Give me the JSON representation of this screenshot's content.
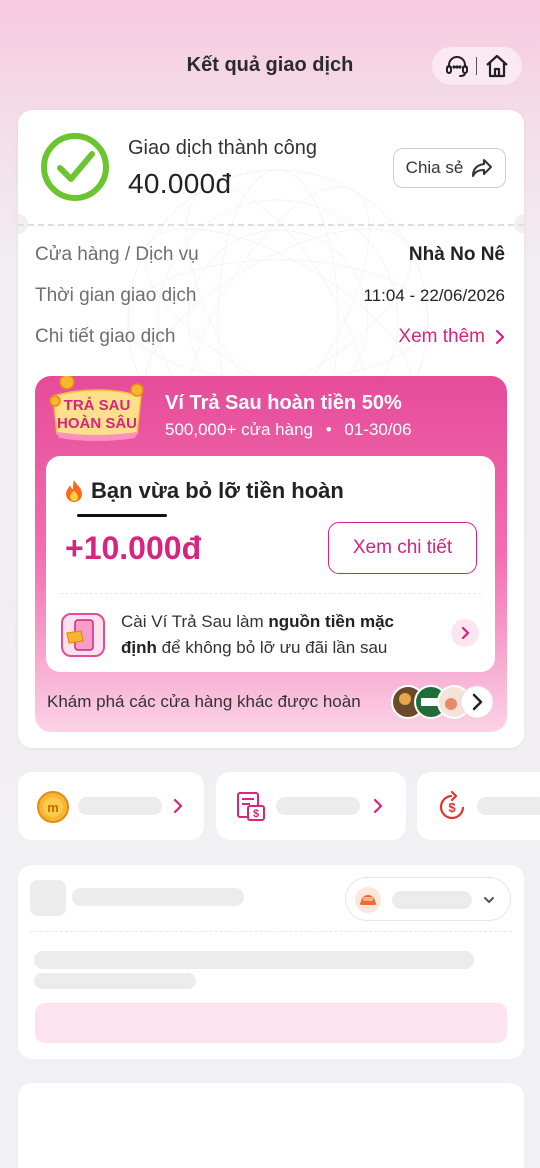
{
  "header": {
    "title": "Kết quả giao dịch",
    "support_icon": "headset-icon",
    "home_icon": "home-icon"
  },
  "result": {
    "status": "Giao dịch thành công",
    "amount": "40.000đ",
    "share_label": "Chia sẻ"
  },
  "details": [
    {
      "key": "Cửa hàng / Dịch vụ",
      "value": "Nhà No Nê"
    },
    {
      "key": "Thời gian giao dịch",
      "value": "11:04 - 22/06/2026"
    },
    {
      "key": "Chi tiết giao dịch",
      "value": "Xem thêm"
    }
  ],
  "promo": {
    "logo_text_line1": "TRẢ SAU",
    "logo_text_line2": "HOÀN SÂU",
    "title": "Ví Trả Sau hoàn tiền 50%",
    "stores": "500,000+ cửa hàng",
    "dates": "01-30/06",
    "missed_title": "Bạn vừa bỏ lỡ tiền hoàn",
    "missed_amount": "+10.000đ",
    "detail_button": "Xem chi tiết",
    "default_text_1": "Cài Ví Trả Sau làm ",
    "default_text_bold_1": "nguồn tiền mặc",
    "default_text_bold_2": "định",
    "default_text_2": " để không bỏ lỡ ưu đãi lần sau",
    "explore_text": "Khám phá các cửa hàng khác được hoàn"
  },
  "colors": {
    "accent": "#d6247f",
    "success": "#6bc430",
    "promo_pink": "#e64b9a"
  }
}
